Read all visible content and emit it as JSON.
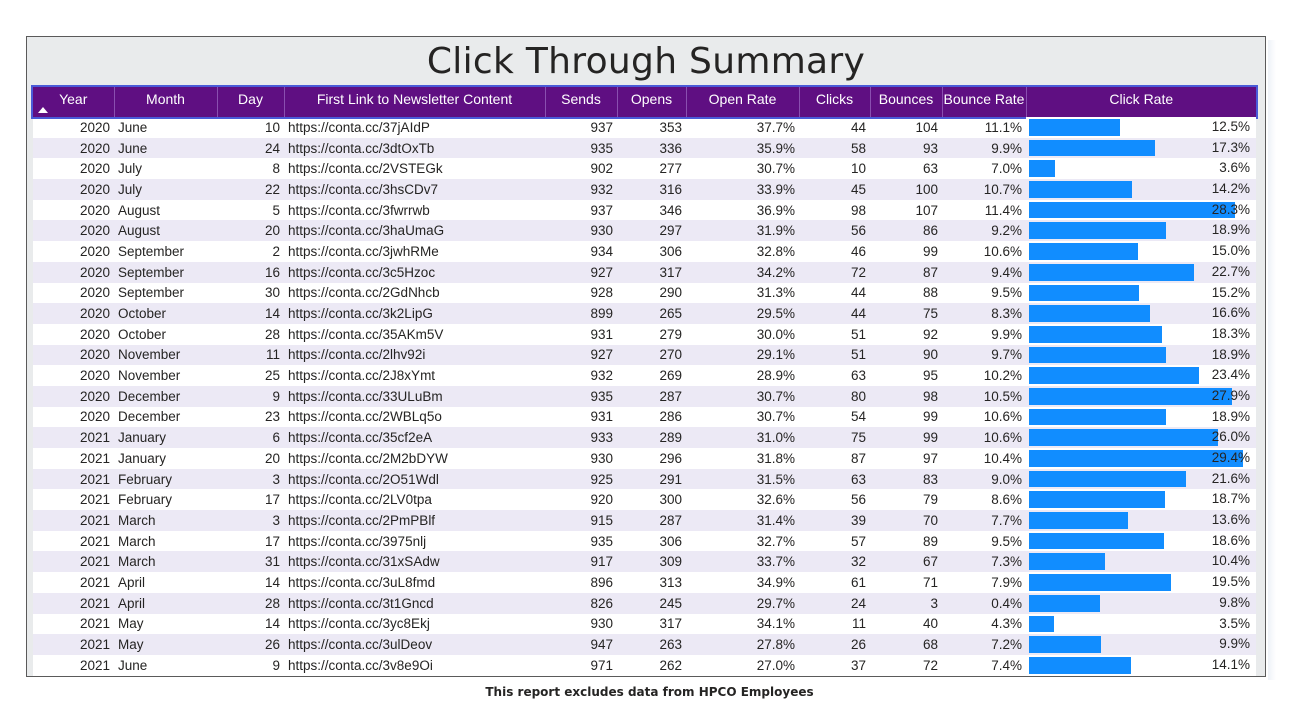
{
  "report": {
    "title": "Click Through Summary",
    "footer": "This report excludes data from HPCO Employees"
  },
  "colors": {
    "header_bg": "#5f0f82",
    "bar": "#118dff",
    "row_alt": "#ece9f5"
  },
  "table": {
    "columns": [
      "Year",
      "Month",
      "Day",
      "First Link to Newsletter Content",
      "Sends",
      "Opens",
      "Open Rate",
      "Clicks",
      "Bounces",
      "Bounce Rate",
      "Click Rate"
    ],
    "sort": {
      "column": "Year",
      "direction": "ascending",
      "icon": "sort-ascending-icon"
    },
    "rows": [
      {
        "year": "2020",
        "month": "June",
        "day": "10",
        "link": "https://conta.cc/37jAIdP",
        "sends": "937",
        "opens": "353",
        "open_rate": "37.7%",
        "clicks": "44",
        "bounces": "104",
        "bounce_rate": "11.1%",
        "click_rate": "12.5%",
        "click_rate_value": 12.5
      },
      {
        "year": "2020",
        "month": "June",
        "day": "24",
        "link": "https://conta.cc/3dtOxTb",
        "sends": "935",
        "opens": "336",
        "open_rate": "35.9%",
        "clicks": "58",
        "bounces": "93",
        "bounce_rate": "9.9%",
        "click_rate": "17.3%",
        "click_rate_value": 17.3
      },
      {
        "year": "2020",
        "month": "July",
        "day": "8",
        "link": "https://conta.cc/2VSTEGk",
        "sends": "902",
        "opens": "277",
        "open_rate": "30.7%",
        "clicks": "10",
        "bounces": "63",
        "bounce_rate": "7.0%",
        "click_rate": "3.6%",
        "click_rate_value": 3.6
      },
      {
        "year": "2020",
        "month": "July",
        "day": "22",
        "link": "https://conta.cc/3hsCDv7",
        "sends": "932",
        "opens": "316",
        "open_rate": "33.9%",
        "clicks": "45",
        "bounces": "100",
        "bounce_rate": "10.7%",
        "click_rate": "14.2%",
        "click_rate_value": 14.2
      },
      {
        "year": "2020",
        "month": "August",
        "day": "5",
        "link": "https://conta.cc/3fwrrwb",
        "sends": "937",
        "opens": "346",
        "open_rate": "36.9%",
        "clicks": "98",
        "bounces": "107",
        "bounce_rate": "11.4%",
        "click_rate": "28.3%",
        "click_rate_value": 28.3
      },
      {
        "year": "2020",
        "month": "August",
        "day": "20",
        "link": "https://conta.cc/3haUmaG",
        "sends": "930",
        "opens": "297",
        "open_rate": "31.9%",
        "clicks": "56",
        "bounces": "86",
        "bounce_rate": "9.2%",
        "click_rate": "18.9%",
        "click_rate_value": 18.9
      },
      {
        "year": "2020",
        "month": "September",
        "day": "2",
        "link": "https://conta.cc/3jwhRMe",
        "sends": "934",
        "opens": "306",
        "open_rate": "32.8%",
        "clicks": "46",
        "bounces": "99",
        "bounce_rate": "10.6%",
        "click_rate": "15.0%",
        "click_rate_value": 15.0
      },
      {
        "year": "2020",
        "month": "September",
        "day": "16",
        "link": "https://conta.cc/3c5Hzoc",
        "sends": "927",
        "opens": "317",
        "open_rate": "34.2%",
        "clicks": "72",
        "bounces": "87",
        "bounce_rate": "9.4%",
        "click_rate": "22.7%",
        "click_rate_value": 22.7
      },
      {
        "year": "2020",
        "month": "September",
        "day": "30",
        "link": "https://conta.cc/2GdNhcb",
        "sends": "928",
        "opens": "290",
        "open_rate": "31.3%",
        "clicks": "44",
        "bounces": "88",
        "bounce_rate": "9.5%",
        "click_rate": "15.2%",
        "click_rate_value": 15.2
      },
      {
        "year": "2020",
        "month": "October",
        "day": "14",
        "link": "https://conta.cc/3k2LipG",
        "sends": "899",
        "opens": "265",
        "open_rate": "29.5%",
        "clicks": "44",
        "bounces": "75",
        "bounce_rate": "8.3%",
        "click_rate": "16.6%",
        "click_rate_value": 16.6
      },
      {
        "year": "2020",
        "month": "October",
        "day": "28",
        "link": "https://conta.cc/35AKm5V",
        "sends": "931",
        "opens": "279",
        "open_rate": "30.0%",
        "clicks": "51",
        "bounces": "92",
        "bounce_rate": "9.9%",
        "click_rate": "18.3%",
        "click_rate_value": 18.3
      },
      {
        "year": "2020",
        "month": "November",
        "day": "11",
        "link": "https://conta.cc/2lhv92i",
        "sends": "927",
        "opens": "270",
        "open_rate": "29.1%",
        "clicks": "51",
        "bounces": "90",
        "bounce_rate": "9.7%",
        "click_rate": "18.9%",
        "click_rate_value": 18.9
      },
      {
        "year": "2020",
        "month": "November",
        "day": "25",
        "link": "https://conta.cc/2J8xYmt",
        "sends": "932",
        "opens": "269",
        "open_rate": "28.9%",
        "clicks": "63",
        "bounces": "95",
        "bounce_rate": "10.2%",
        "click_rate": "23.4%",
        "click_rate_value": 23.4
      },
      {
        "year": "2020",
        "month": "December",
        "day": "9",
        "link": "https://conta.cc/33ULuBm",
        "sends": "935",
        "opens": "287",
        "open_rate": "30.7%",
        "clicks": "80",
        "bounces": "98",
        "bounce_rate": "10.5%",
        "click_rate": "27.9%",
        "click_rate_value": 27.9
      },
      {
        "year": "2020",
        "month": "December",
        "day": "23",
        "link": "https://conta.cc/2WBLq5o",
        "sends": "931",
        "opens": "286",
        "open_rate": "30.7%",
        "clicks": "54",
        "bounces": "99",
        "bounce_rate": "10.6%",
        "click_rate": "18.9%",
        "click_rate_value": 18.9
      },
      {
        "year": "2021",
        "month": "January",
        "day": "6",
        "link": "https://conta.cc/35cf2eA",
        "sends": "933",
        "opens": "289",
        "open_rate": "31.0%",
        "clicks": "75",
        "bounces": "99",
        "bounce_rate": "10.6%",
        "click_rate": "26.0%",
        "click_rate_value": 26.0
      },
      {
        "year": "2021",
        "month": "January",
        "day": "20",
        "link": "https://conta.cc/2M2bDYW",
        "sends": "930",
        "opens": "296",
        "open_rate": "31.8%",
        "clicks": "87",
        "bounces": "97",
        "bounce_rate": "10.4%",
        "click_rate": "29.4%",
        "click_rate_value": 29.4
      },
      {
        "year": "2021",
        "month": "February",
        "day": "3",
        "link": "https://conta.cc/2O51Wdl",
        "sends": "925",
        "opens": "291",
        "open_rate": "31.5%",
        "clicks": "63",
        "bounces": "83",
        "bounce_rate": "9.0%",
        "click_rate": "21.6%",
        "click_rate_value": 21.6
      },
      {
        "year": "2021",
        "month": "February",
        "day": "17",
        "link": "https://conta.cc/2LV0tpa",
        "sends": "920",
        "opens": "300",
        "open_rate": "32.6%",
        "clicks": "56",
        "bounces": "79",
        "bounce_rate": "8.6%",
        "click_rate": "18.7%",
        "click_rate_value": 18.7
      },
      {
        "year": "2021",
        "month": "March",
        "day": "3",
        "link": "https://conta.cc/2PmPBlf",
        "sends": "915",
        "opens": "287",
        "open_rate": "31.4%",
        "clicks": "39",
        "bounces": "70",
        "bounce_rate": "7.7%",
        "click_rate": "13.6%",
        "click_rate_value": 13.6
      },
      {
        "year": "2021",
        "month": "March",
        "day": "17",
        "link": "https://conta.cc/3975nlj",
        "sends": "935",
        "opens": "306",
        "open_rate": "32.7%",
        "clicks": "57",
        "bounces": "89",
        "bounce_rate": "9.5%",
        "click_rate": "18.6%",
        "click_rate_value": 18.6
      },
      {
        "year": "2021",
        "month": "March",
        "day": "31",
        "link": "https://conta.cc/31xSAdw",
        "sends": "917",
        "opens": "309",
        "open_rate": "33.7%",
        "clicks": "32",
        "bounces": "67",
        "bounce_rate": "7.3%",
        "click_rate": "10.4%",
        "click_rate_value": 10.4
      },
      {
        "year": "2021",
        "month": "April",
        "day": "14",
        "link": "https://conta.cc/3uL8fmd",
        "sends": "896",
        "opens": "313",
        "open_rate": "34.9%",
        "clicks": "61",
        "bounces": "71",
        "bounce_rate": "7.9%",
        "click_rate": "19.5%",
        "click_rate_value": 19.5
      },
      {
        "year": "2021",
        "month": "April",
        "day": "28",
        "link": "https://conta.cc/3t1Gncd",
        "sends": "826",
        "opens": "245",
        "open_rate": "29.7%",
        "clicks": "24",
        "bounces": "3",
        "bounce_rate": "0.4%",
        "click_rate": "9.8%",
        "click_rate_value": 9.8
      },
      {
        "year": "2021",
        "month": "May",
        "day": "14",
        "link": "https://conta.cc/3yc8Ekj",
        "sends": "930",
        "opens": "317",
        "open_rate": "34.1%",
        "clicks": "11",
        "bounces": "40",
        "bounce_rate": "4.3%",
        "click_rate": "3.5%",
        "click_rate_value": 3.5
      },
      {
        "year": "2021",
        "month": "May",
        "day": "26",
        "link": "https://conta.cc/3ulDeov",
        "sends": "947",
        "opens": "263",
        "open_rate": "27.8%",
        "clicks": "26",
        "bounces": "68",
        "bounce_rate": "7.2%",
        "click_rate": "9.9%",
        "click_rate_value": 9.9
      },
      {
        "year": "2021",
        "month": "June",
        "day": "9",
        "link": "https://conta.cc/3v8e9Oi",
        "sends": "971",
        "opens": "262",
        "open_rate": "27.0%",
        "clicks": "37",
        "bounces": "72",
        "bounce_rate": "7.4%",
        "click_rate": "14.1%",
        "click_rate_value": 14.1
      }
    ]
  }
}
